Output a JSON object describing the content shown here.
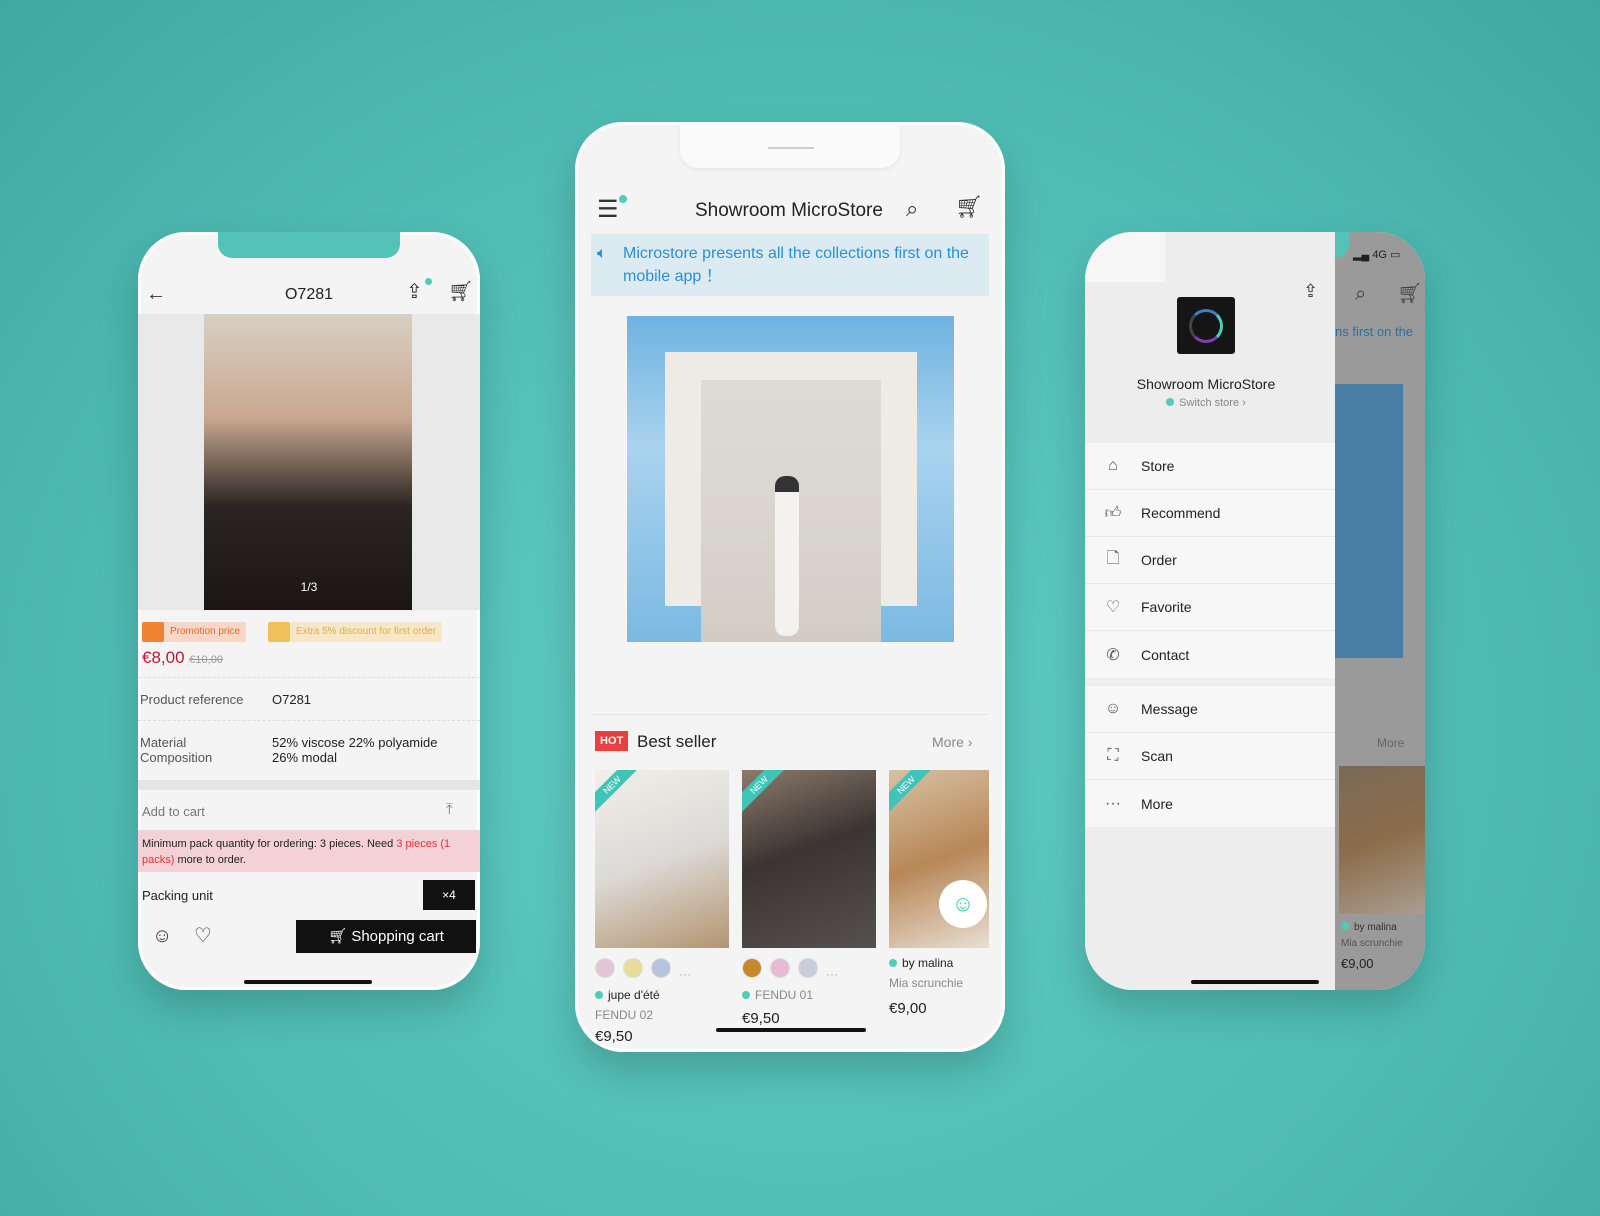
{
  "left_phone": {
    "title": "O7281",
    "image_counter": "1/3",
    "badges": {
      "promotion": "Promotion price",
      "discount": "Extra 5% discount for first order"
    },
    "price": "€8,00",
    "old_price": "€10,00",
    "specs": [
      {
        "label": "Product reference",
        "value": "O7281"
      },
      {
        "label": "Material Composition",
        "value": "52% viscose 22% polyamide 26% modal"
      }
    ],
    "add_to_cart": "Add to cart",
    "notice": {
      "text": "Minimum pack quantity for ordering: 3 pieces. Need ",
      "highlight": "3 pieces (1 packs)",
      "end": " more to order."
    },
    "packing_unit": "Packing unit",
    "packing_value": "×4",
    "cart_button": "Shopping cart"
  },
  "center_phone": {
    "title": "Showroom MicroStore",
    "announcement": "Microstore presents all the collections first on the mobile app ！",
    "section": {
      "hot": "HOT",
      "title": "Best seller",
      "more": "More"
    },
    "new_tag": "NEW",
    "products": [
      {
        "store": "jupe d'été",
        "name": "FENDU 02",
        "price": "€9,50"
      },
      {
        "store": "FENDU 01",
        "name": "",
        "price": "€9,50"
      },
      {
        "store": "by malina",
        "name": "Mia scrunchie",
        "price": "€9,00"
      }
    ],
    "more_dots": "···"
  },
  "right_phone": {
    "status": "4G",
    "store_name": "Showroom MicroStore",
    "switch_store": "Switch store",
    "menu": [
      "Store",
      "Recommend",
      "Order",
      "Favorite",
      "Contact",
      "Message",
      "Scan",
      "More"
    ],
    "bg_text": "ns first on the",
    "bg_more": "More",
    "bg_store": "by malina",
    "bg_name": "Mia scrunchie",
    "bg_price": "€9,00"
  },
  "colors": {
    "accent": "#4ecdb7",
    "price": "#c0163a",
    "hot": "#e8403c",
    "announcement": "#2a8fd6",
    "background": "#55c2ba"
  }
}
